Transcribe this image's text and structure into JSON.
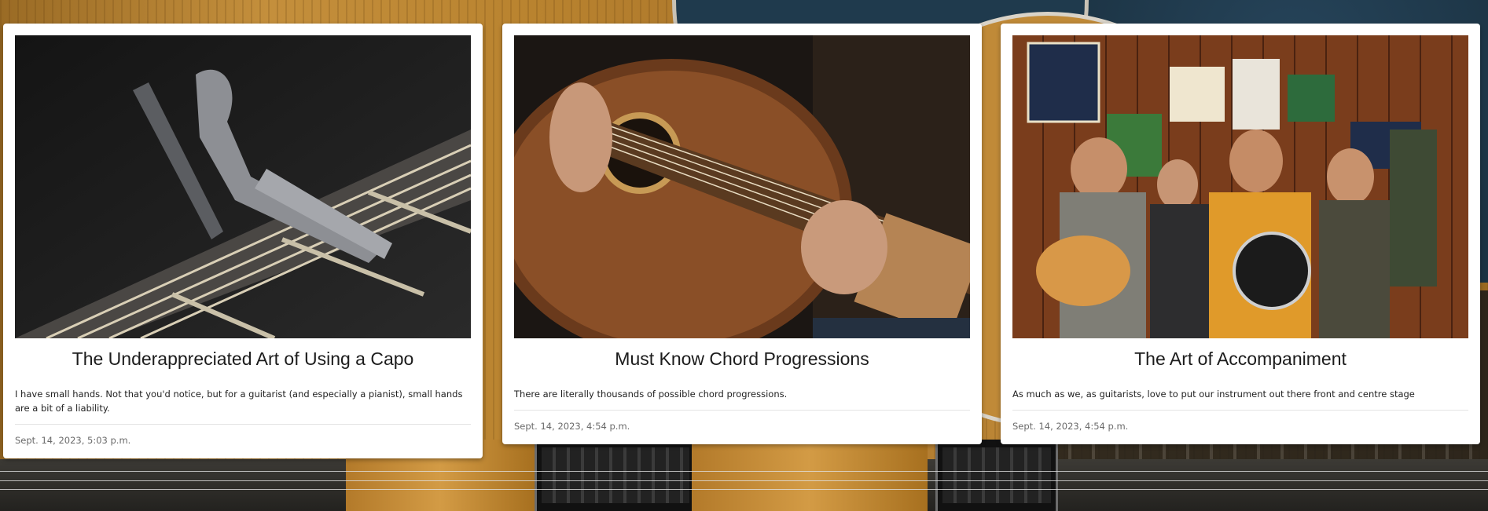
{
  "cards": [
    {
      "title": "The Underappreciated Art of Using a Capo",
      "description": "I have small hands. Not that you'd notice, but for a guitarist (and especially a pianist), small hands are a bit of a liability.",
      "date": "Sept. 14, 2023, 5:03 p.m.",
      "image": "capo-on-guitar-neck-photo"
    },
    {
      "title": "Must Know Chord Progressions",
      "description": "There are literally thousands of possible chord progressions.",
      "date": "Sept. 14, 2023, 4:54 p.m.",
      "image": "acoustic-guitar-playing-photo"
    },
    {
      "title": "The Art of Accompaniment",
      "description": "As much as we, as guitarists, love to put our instrument out there front and centre stage",
      "date": "Sept. 14, 2023, 4:54 p.m.",
      "image": "pub-band-performance-photo"
    }
  ],
  "colors": {
    "card_background": "#ffffff",
    "title_text": "#1c1c1c",
    "date_text": "#6a6a6a",
    "divider": "#e3e3e3"
  }
}
